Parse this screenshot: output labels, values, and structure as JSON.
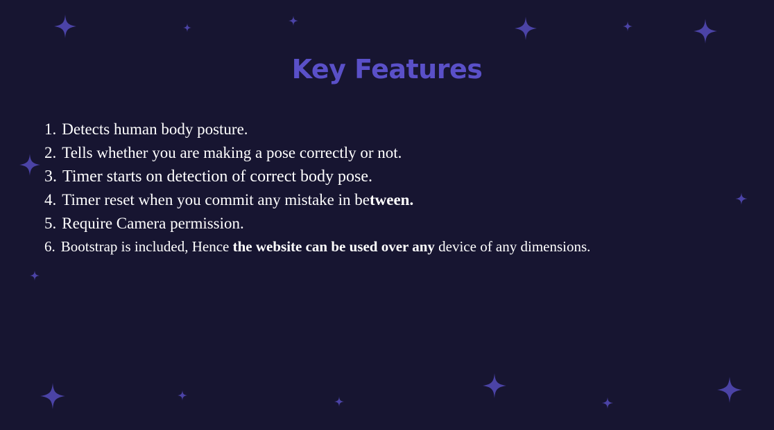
{
  "slide": {
    "title": "Key Features",
    "background_color": "#171531",
    "accent_color": "#5a50c8",
    "sparkle_color": "#4b43a6"
  },
  "features": [
    {
      "number": "1.",
      "parts": [
        "Detects human body posture."
      ]
    },
    {
      "number": "2.",
      "parts": [
        "Tells whether you are making a pose correctly or not."
      ]
    },
    {
      "number": "3.",
      "parts": [
        "Timer starts on detection of correct body pose."
      ]
    },
    {
      "number": "4.",
      "parts": [
        "Timer reset when you commit any mistake in be",
        "tween."
      ]
    },
    {
      "number": "5.",
      "parts": [
        "Require Camera permission."
      ]
    },
    {
      "number": "6.",
      "parts": [
        "Bootstrap is included, Hence ",
        "the website can be used over any",
        " device of any dimensions."
      ]
    }
  ],
  "decorations": {
    "icon": "sparkle-icon"
  }
}
